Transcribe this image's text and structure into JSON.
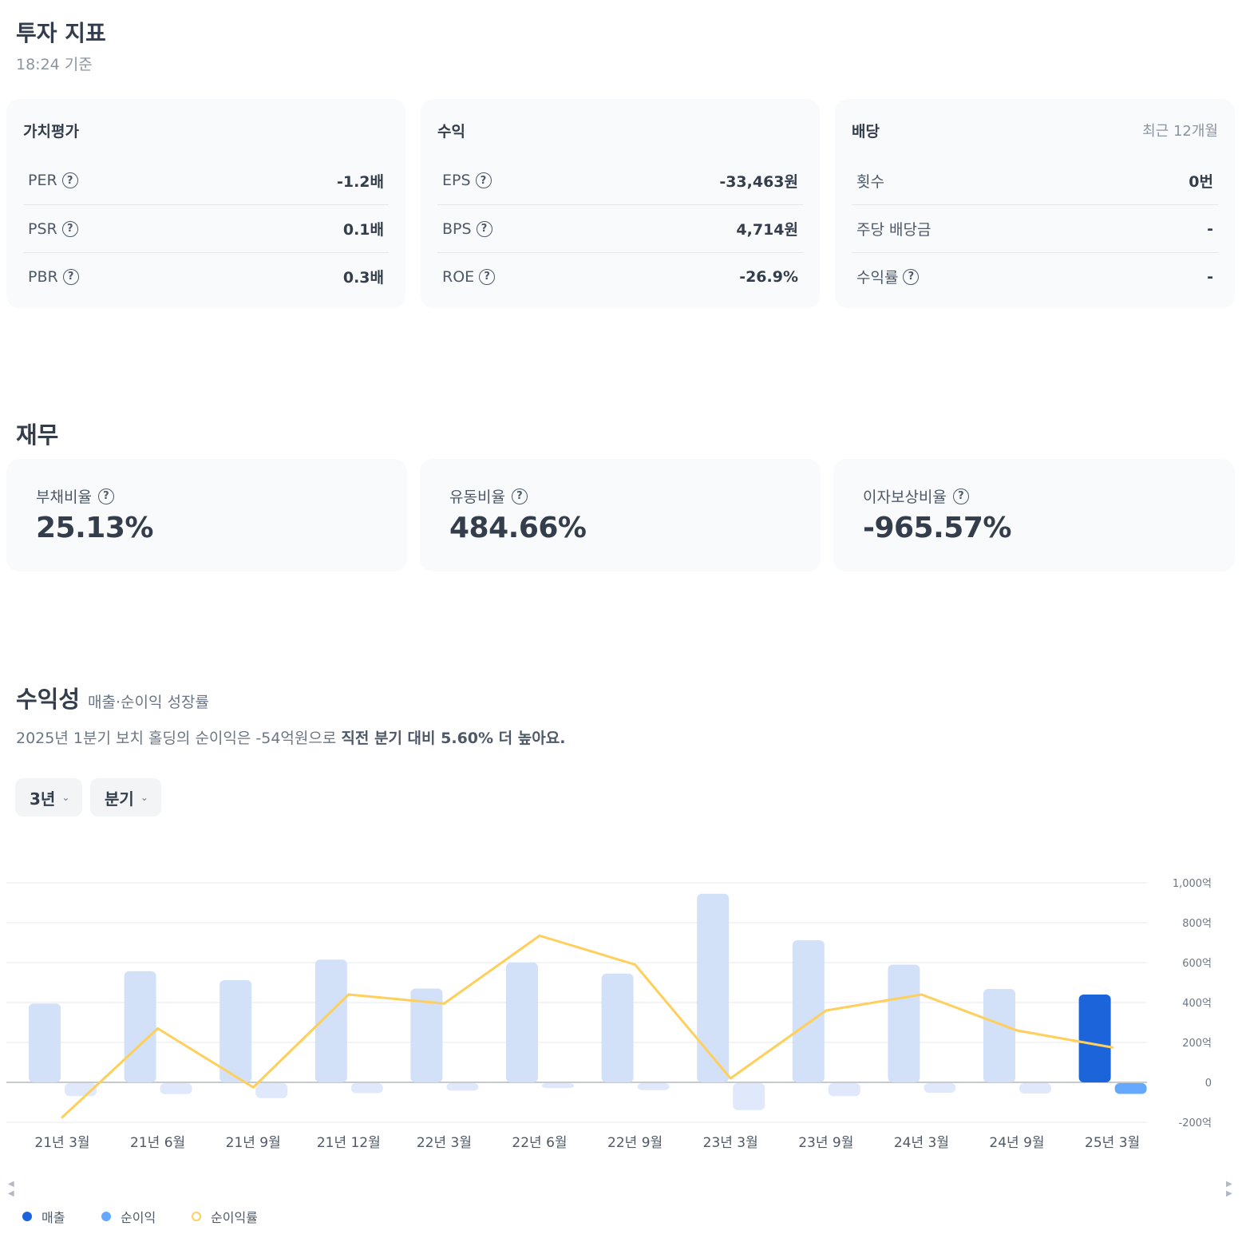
{
  "header": {
    "title": "투자 지표",
    "subtitle": "18:24 기준"
  },
  "valuation": {
    "title": "가치평가",
    "rows": [
      {
        "label": "PER",
        "value": "-1.2배"
      },
      {
        "label": "PSR",
        "value": "0.1배"
      },
      {
        "label": "PBR",
        "value": "0.3배"
      }
    ]
  },
  "earnings": {
    "title": "수익",
    "rows": [
      {
        "label": "EPS",
        "value": "-33,463원"
      },
      {
        "label": "BPS",
        "value": "4,714원"
      },
      {
        "label": "ROE",
        "value": "-26.9%"
      }
    ]
  },
  "dividend": {
    "title": "배당",
    "aside": "최근 12개월",
    "rows": [
      {
        "label": "횟수",
        "value": "0번"
      },
      {
        "label": "주당 배당금",
        "value": "-"
      },
      {
        "label": "수익률",
        "value": "-"
      }
    ]
  },
  "help_glyph": "?",
  "finance": {
    "title": "재무",
    "cards": [
      {
        "label": "부채비율",
        "value": "25.13%"
      },
      {
        "label": "유동비율",
        "value": "484.66%"
      },
      {
        "label": "이자보상비율",
        "value": "-965.57%"
      }
    ]
  },
  "profitability": {
    "title": "수익성",
    "subtitle": "매출·순이익 성장률",
    "desc_plain": "2025년 1분기 보치 홀딩의 순이익은 -54억원으로 ",
    "desc_bold": "직전 분기 대비 5.60% 더 높아요.",
    "period_select": "3년",
    "interval_select": "분기"
  },
  "legend": {
    "revenue": "매출",
    "net_income": "순이익",
    "net_margin": "순이익률"
  },
  "colors": {
    "revenue": "#d2e0f8",
    "revenue_highlight": "#1b64da",
    "net_income": "#dfe9fb",
    "net_income_highlight": "#64a8ff",
    "net_margin": "#ffcf5c",
    "grid": "#e5e8eb"
  },
  "chart_data": {
    "type": "bar",
    "categories": [
      "21년 3월",
      "21년 6월",
      "21년 9월",
      "21년 12월",
      "22년 3월",
      "22년 6월",
      "22년 9월",
      "23년 3월",
      "23년 9월",
      "24년 3월",
      "24년 9월",
      "25년 3월"
    ],
    "y_ticks": [
      "1,000억",
      "800억",
      "600억",
      "400억",
      "200억",
      "0",
      "-200억"
    ],
    "ylim": [
      -200,
      1000
    ],
    "grid": true,
    "series": [
      {
        "name": "매출",
        "values": [
          395,
          557,
          512,
          615,
          470,
          600,
          545,
          945,
          712,
          590,
          468,
          440
        ]
      },
      {
        "name": "순이익",
        "values": [
          -65,
          -55,
          -75,
          -50,
          -38,
          -25,
          -35,
          -135,
          -65,
          -48,
          -52,
          -54
        ]
      },
      {
        "name": "순이익률",
        "values": [
          -175,
          270,
          -25,
          440,
          395,
          735,
          590,
          20,
          360,
          440,
          260,
          175
        ]
      }
    ]
  }
}
